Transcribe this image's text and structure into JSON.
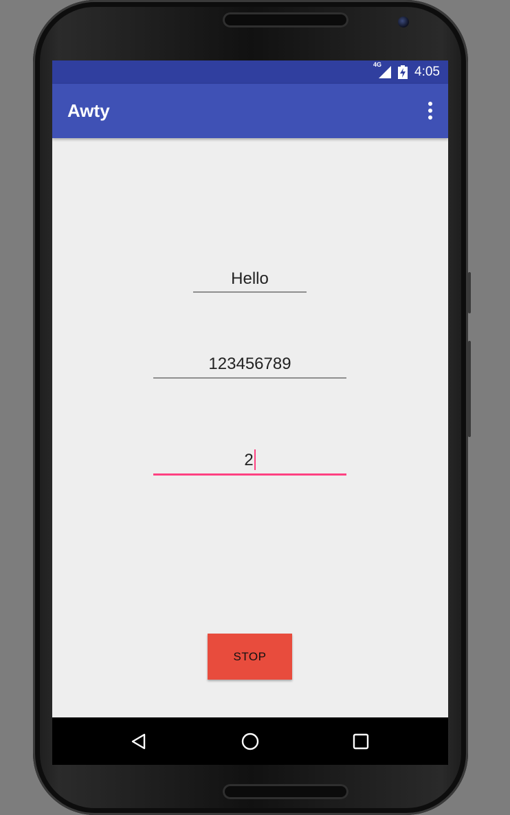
{
  "status_bar": {
    "network": "4G",
    "time": "4:05"
  },
  "app_bar": {
    "title": "Awty",
    "overflow_icon": "more-vert-icon"
  },
  "fields": {
    "message": {
      "value": "Hello"
    },
    "phone": {
      "value": "123456789"
    },
    "interval": {
      "value": "2"
    }
  },
  "actions": {
    "stop_label": "STOP"
  },
  "nav": {
    "back_icon": "back-triangle-icon",
    "home_icon": "home-circle-icon",
    "recents_icon": "recents-square-icon"
  },
  "colors": {
    "status_bar": "#303f9f",
    "app_bar": "#3f51b5",
    "accent": "#ff4081",
    "stop_button": "#e84c3d",
    "background": "#eeeeee"
  }
}
